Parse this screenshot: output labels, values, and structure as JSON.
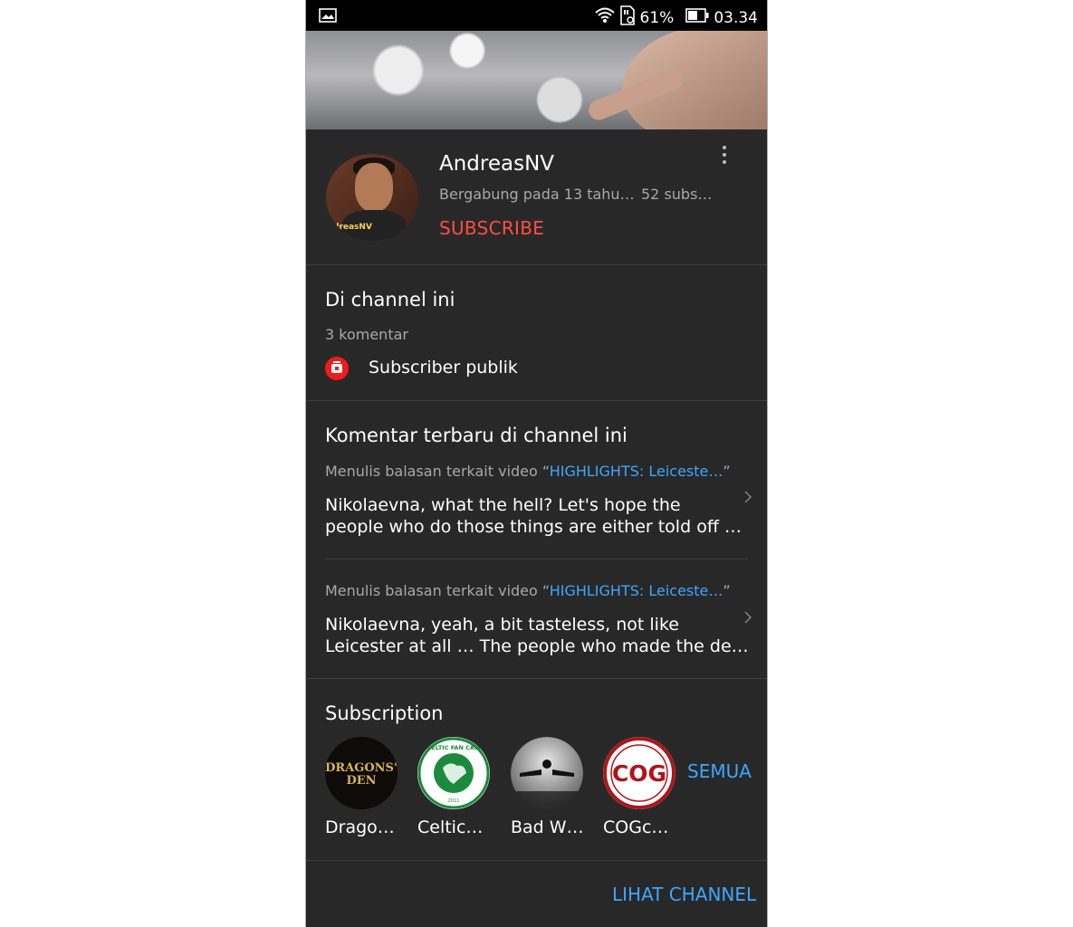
{
  "status_bar": {
    "battery": "61%",
    "time": "03.34"
  },
  "channel": {
    "name": "AndreasNV",
    "joined": "Bergabung pada 13 tahu…",
    "subscribers": "52 subs…",
    "subscribe_label": "SUBSCRIBE",
    "avatar_tag": "dreasNV"
  },
  "on_channel": {
    "title": "Di channel ini",
    "comments_count": "3 komentar",
    "public_label": "Subscriber publik"
  },
  "recent_comments": {
    "title": "Komentar terbaru di channel ini",
    "items": [
      {
        "reply_prefix": "Menulis balasan terkait video “",
        "video_link": "HIGHLIGHTS: Leiceste…",
        "reply_suffix": "”",
        "line1": "Nikolaevna, what the hell? Let's hope the",
        "line2": "people who do those things are either told off …"
      },
      {
        "reply_prefix": "Menulis balasan terkait video “",
        "video_link": "HIGHLIGHTS: Leiceste…",
        "reply_suffix": "”",
        "line1": "Nikolaevna, yeah, a bit tasteless, not like",
        "line2": "Leicester at all … The people who made the de…"
      }
    ]
  },
  "subscriptions": {
    "title": "Subscription",
    "items": [
      {
        "label": "Drago…",
        "logo_line1": "DRAGONS'",
        "logo_line2": "DEN"
      },
      {
        "label": "Celtic…",
        "logo_line1": "CELTIC FAN CAM",
        "logo_line2": "2011"
      },
      {
        "label": "Bad W…"
      },
      {
        "label": "COGc…",
        "logo_line1": "COG"
      }
    ],
    "all_label": "SEMUA"
  },
  "footer": {
    "view_channel_label": "LIHAT CHANNEL"
  },
  "colors": {
    "background": "#282828",
    "accent_blue": "#3ea6ff",
    "subscribe_red": "#ff4e45"
  }
}
